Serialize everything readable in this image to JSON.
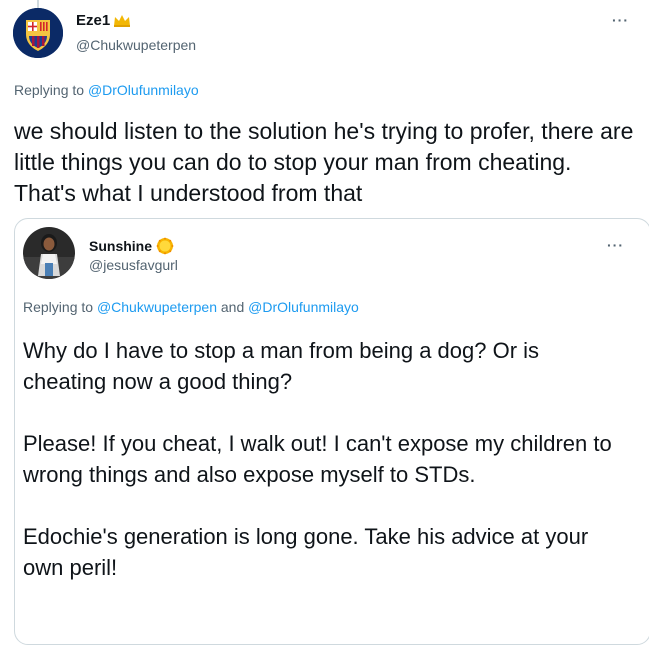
{
  "tweet": {
    "display_name": "Eze1",
    "handle": "@Chukwupeterpen",
    "replying_prefix": "Replying to ",
    "replying_to": "@DrOlufunmilayo",
    "more_label": "···",
    "text": "we should listen to the solution he's trying to profer, there are little things you can do to stop your man from cheating. That's what I understood from that",
    "name_emoji": "crown-icon"
  },
  "quoted_tweet": {
    "display_name": "Sunshine",
    "handle": "@jesusfavgurl",
    "replying_prefix": "Replying to ",
    "replying_to_1": "@Chukwupeterpen",
    "replying_and": " and ",
    "replying_to_2": "@DrOlufunmilayo",
    "more_label": "···",
    "name_emoji": "sun-icon",
    "paragraphs": [
      "Why do I have to stop a man from being a dog? Or is cheating now a good thing?",
      "Please! If you cheat, I walk out! I can't expose my children to wrong things and also expose myself to STDs.",
      "Edochie's generation is long gone. Take his advice at your own peril!"
    ]
  },
  "colors": {
    "text_primary": "#0f1419",
    "text_secondary": "#536471",
    "link": "#1d9bf0",
    "border": "#cfd9de"
  }
}
